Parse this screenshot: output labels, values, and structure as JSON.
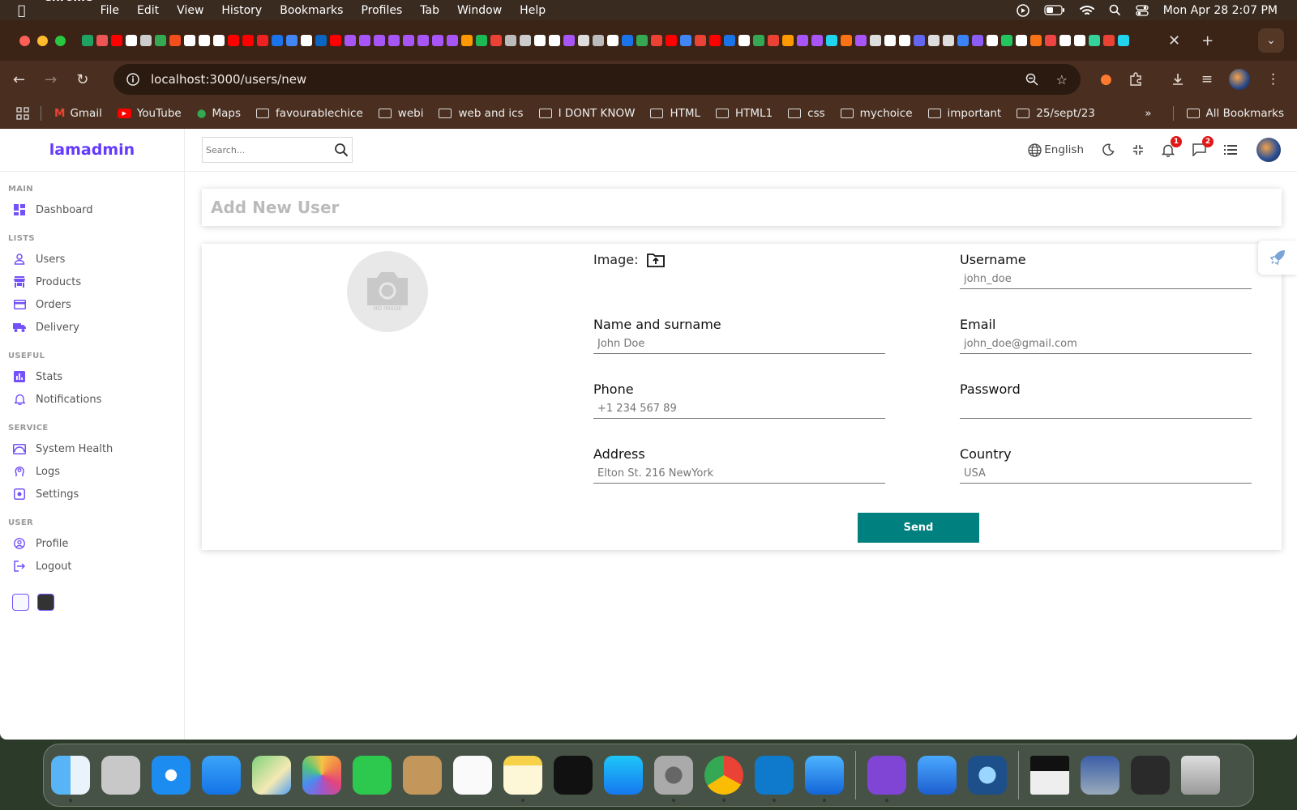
{
  "menubar": {
    "app": "Chrome",
    "menus": [
      "File",
      "Edit",
      "View",
      "History",
      "Bookmarks",
      "Profiles",
      "Tab",
      "Window",
      "Help"
    ],
    "datetime": "Mon Apr 28  2:07 PM"
  },
  "browser": {
    "url": "localhost:3000/users/new",
    "bookmarks": [
      "Gmail",
      "YouTube",
      "Maps",
      "favourablechice",
      "webi",
      "web and ics",
      "I DONT KNOW",
      "HTML",
      "HTML1",
      "css",
      "mychoice",
      "important",
      "25/sept/23"
    ],
    "all_bookmarks": "All Bookmarks"
  },
  "app": {
    "logo": "lamadmin",
    "search_placeholder": "Search...",
    "language": "English",
    "notifications_count": "1",
    "messages_count": "2",
    "sidebar": {
      "main": "MAIN",
      "dashboard": "Dashboard",
      "lists": "LISTS",
      "users": "Users",
      "products": "Products",
      "orders": "Orders",
      "delivery": "Delivery",
      "useful": "USEFUL",
      "stats": "Stats",
      "notifications": "Notifications",
      "service": "SERVICE",
      "system_health": "System Health",
      "logs": "Logs",
      "settings": "Settings",
      "user": "USER",
      "profile": "Profile",
      "logout": "Logout"
    },
    "page_title": "Add New User",
    "no_image": "NO IMAGE",
    "form": {
      "image_label": "Image:",
      "username_label": "Username",
      "username_placeholder": "john_doe",
      "name_label": "Name and surname",
      "name_placeholder": "John Doe",
      "email_label": "Email",
      "email_placeholder": "john_doe@gmail.com",
      "phone_label": "Phone",
      "phone_placeholder": "+1 234 567 89",
      "password_label": "Password",
      "password_placeholder": "",
      "address_label": "Address",
      "address_placeholder": "Elton St. 216 NewYork",
      "country_label": "Country",
      "country_placeholder": "USA",
      "send": "Send"
    }
  }
}
